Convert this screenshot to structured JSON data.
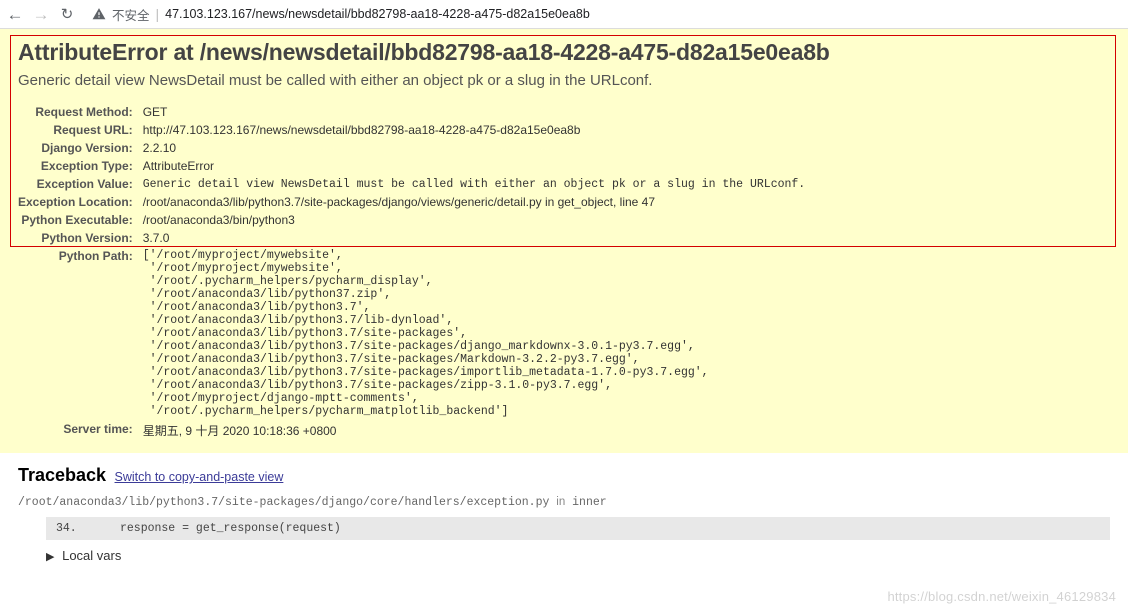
{
  "browser": {
    "insecure_label": "不安全",
    "url": "47.103.123.167/news/newsdetail/bbd82798-aa18-4228-a475-d82a15e0ea8b"
  },
  "summary": {
    "heading": "AttributeError at /news/newsdetail/bbd82798-aa18-4228-a475-d82a15e0ea8b",
    "exception_message": "Generic detail view NewsDetail must be called with either an object pk or a slug in the URLconf.",
    "rows": {
      "request_method": {
        "label": "Request Method:",
        "value": "GET"
      },
      "request_url": {
        "label": "Request URL:",
        "value": "http://47.103.123.167/news/newsdetail/bbd82798-aa18-4228-a475-d82a15e0ea8b"
      },
      "django_version": {
        "label": "Django Version:",
        "value": "2.2.10"
      },
      "exception_type": {
        "label": "Exception Type:",
        "value": "AttributeError"
      },
      "exception_value": {
        "label": "Exception Value:",
        "value": "Generic detail view NewsDetail must be called with either an object pk or a slug in the URLconf."
      },
      "exception_location": {
        "label": "Exception Location:",
        "value": "/root/anaconda3/lib/python3.7/site-packages/django/views/generic/detail.py in get_object, line 47"
      },
      "python_executable": {
        "label": "Python Executable:",
        "value": "/root/anaconda3/bin/python3"
      },
      "python_version": {
        "label": "Python Version:",
        "value": "3.7.0"
      },
      "python_path": {
        "label": "Python Path:",
        "value": "['/root/myproject/mywebsite',\n '/root/myproject/mywebsite',\n '/root/.pycharm_helpers/pycharm_display',\n '/root/anaconda3/lib/python37.zip',\n '/root/anaconda3/lib/python3.7',\n '/root/anaconda3/lib/python3.7/lib-dynload',\n '/root/anaconda3/lib/python3.7/site-packages',\n '/root/anaconda3/lib/python3.7/site-packages/django_markdownx-3.0.1-py3.7.egg',\n '/root/anaconda3/lib/python3.7/site-packages/Markdown-3.2.2-py3.7.egg',\n '/root/anaconda3/lib/python3.7/site-packages/importlib_metadata-1.7.0-py3.7.egg',\n '/root/anaconda3/lib/python3.7/site-packages/zipp-3.1.0-py3.7.egg',\n '/root/myproject/django-mptt-comments',\n '/root/.pycharm_helpers/pycharm_matplotlib_backend']"
      },
      "server_time": {
        "label": "Server time:",
        "value": "星期五, 9 十月 2020 10:18:36 +0800"
      }
    }
  },
  "traceback": {
    "heading": "Traceback",
    "switch_link": "Switch to copy-and-paste view",
    "frame": {
      "file": "/root/anaconda3/lib/python3.7/site-packages/django/core/handlers/exception.py",
      "in_word": "in",
      "func": "inner",
      "lineno": "34.",
      "code": "response = get_response(request)"
    },
    "local_vars_label": "Local vars"
  },
  "watermark": "https://blog.csdn.net/weixin_46129834"
}
